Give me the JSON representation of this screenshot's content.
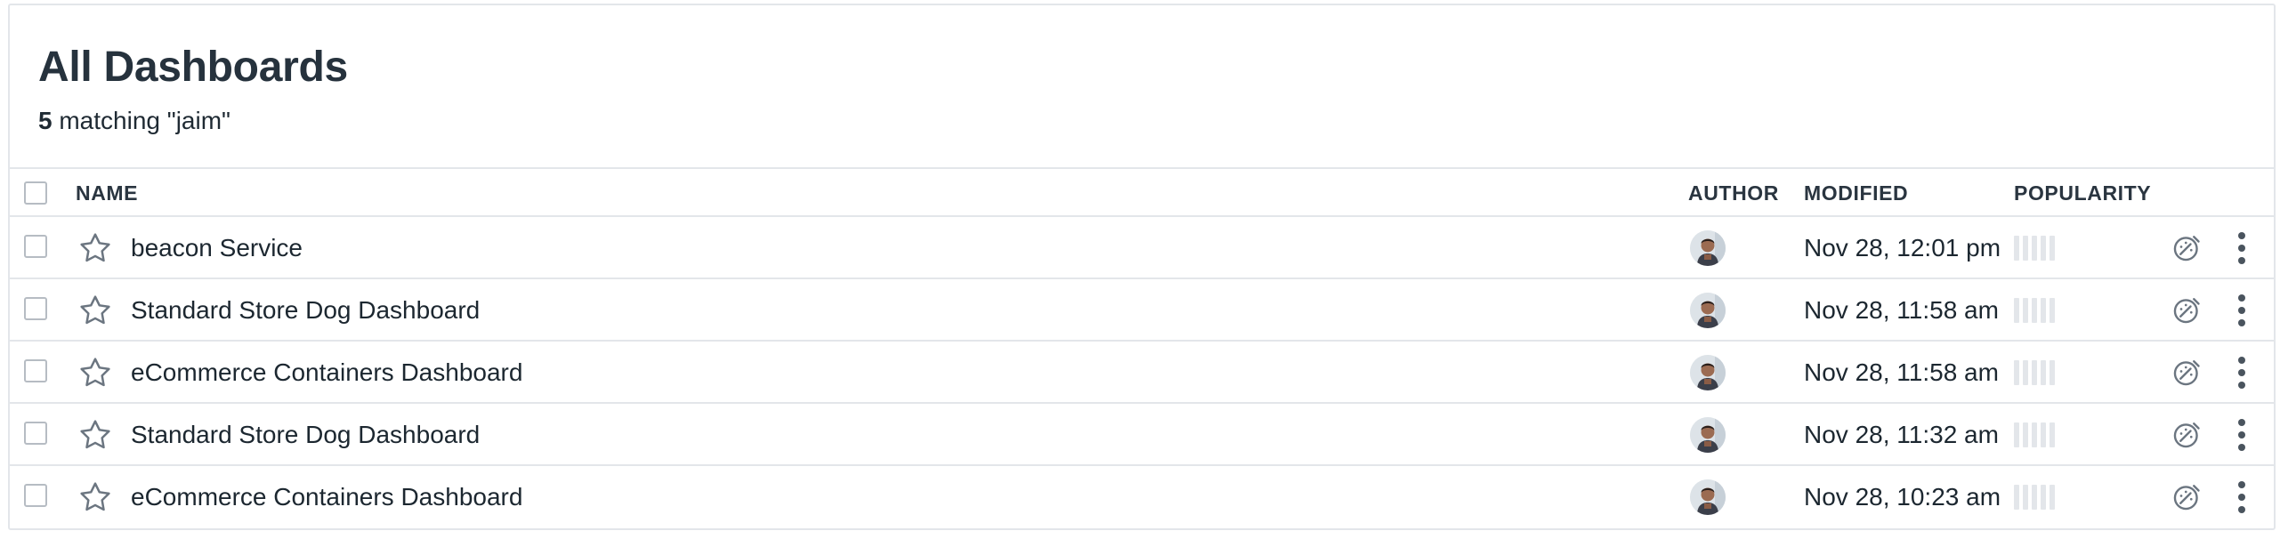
{
  "header": {
    "title": "All Dashboards",
    "match_count": "5",
    "match_text": " matching \"jaim\""
  },
  "columns": {
    "name": "NAME",
    "author": "AUTHOR",
    "modified": "MODIFIED",
    "popularity": "POPULARITY"
  },
  "rows": [
    {
      "name": "beacon Service",
      "modified": "Nov 28, 12:01 pm",
      "popularity": 0,
      "starred": false
    },
    {
      "name": "Standard Store Dog Dashboard",
      "modified": "Nov 28, 11:58 am",
      "popularity": 0,
      "starred": false
    },
    {
      "name": "eCommerce Containers Dashboard",
      "modified": "Nov 28, 11:58 am",
      "popularity": 0,
      "starred": false
    },
    {
      "name": "Standard Store Dog Dashboard",
      "modified": "Nov 28, 11:32 am",
      "popularity": 0,
      "starred": false
    },
    {
      "name": "eCommerce Containers Dashboard",
      "modified": "Nov 28, 10:23 am",
      "popularity": 0,
      "starred": false
    }
  ],
  "popularity_scale_max": 5,
  "icons": {
    "row_favorite": "star-icon",
    "row_author": "avatar",
    "row_monitor": "monitor-icon",
    "row_menu": "more-vertical-icon"
  },
  "colors": {
    "border": "#e3e6ea",
    "text": "#1c2730",
    "icon": "#6b7580",
    "popularity_empty": "#e3e6ea"
  }
}
